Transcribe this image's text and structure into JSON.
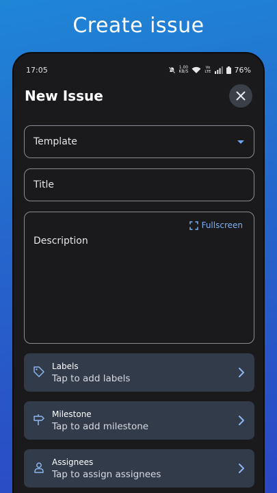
{
  "promo": {
    "title": "Create issue"
  },
  "status_bar": {
    "time": "17:05",
    "speed_value": "1.00",
    "speed_unit": "KB/S",
    "volte_top": "Vo",
    "volte_bottom": "LTE",
    "battery": "76%"
  },
  "header": {
    "title": "New Issue"
  },
  "form": {
    "template_label": "Template",
    "title_placeholder": "Title",
    "description_placeholder": "Description",
    "fullscreen_label": "Fullscreen"
  },
  "rows": [
    {
      "title": "Labels",
      "subtitle": "Tap to add labels",
      "icon": "tag-icon"
    },
    {
      "title": "Milestone",
      "subtitle": "Tap to add milestone",
      "icon": "signpost-icon"
    },
    {
      "title": "Assignees",
      "subtitle": "Tap to assign assignees",
      "icon": "person-icon"
    }
  ],
  "colors": {
    "accent": "#6ea8f5",
    "card": "#323b4a",
    "surface": "#1a1a1d"
  }
}
